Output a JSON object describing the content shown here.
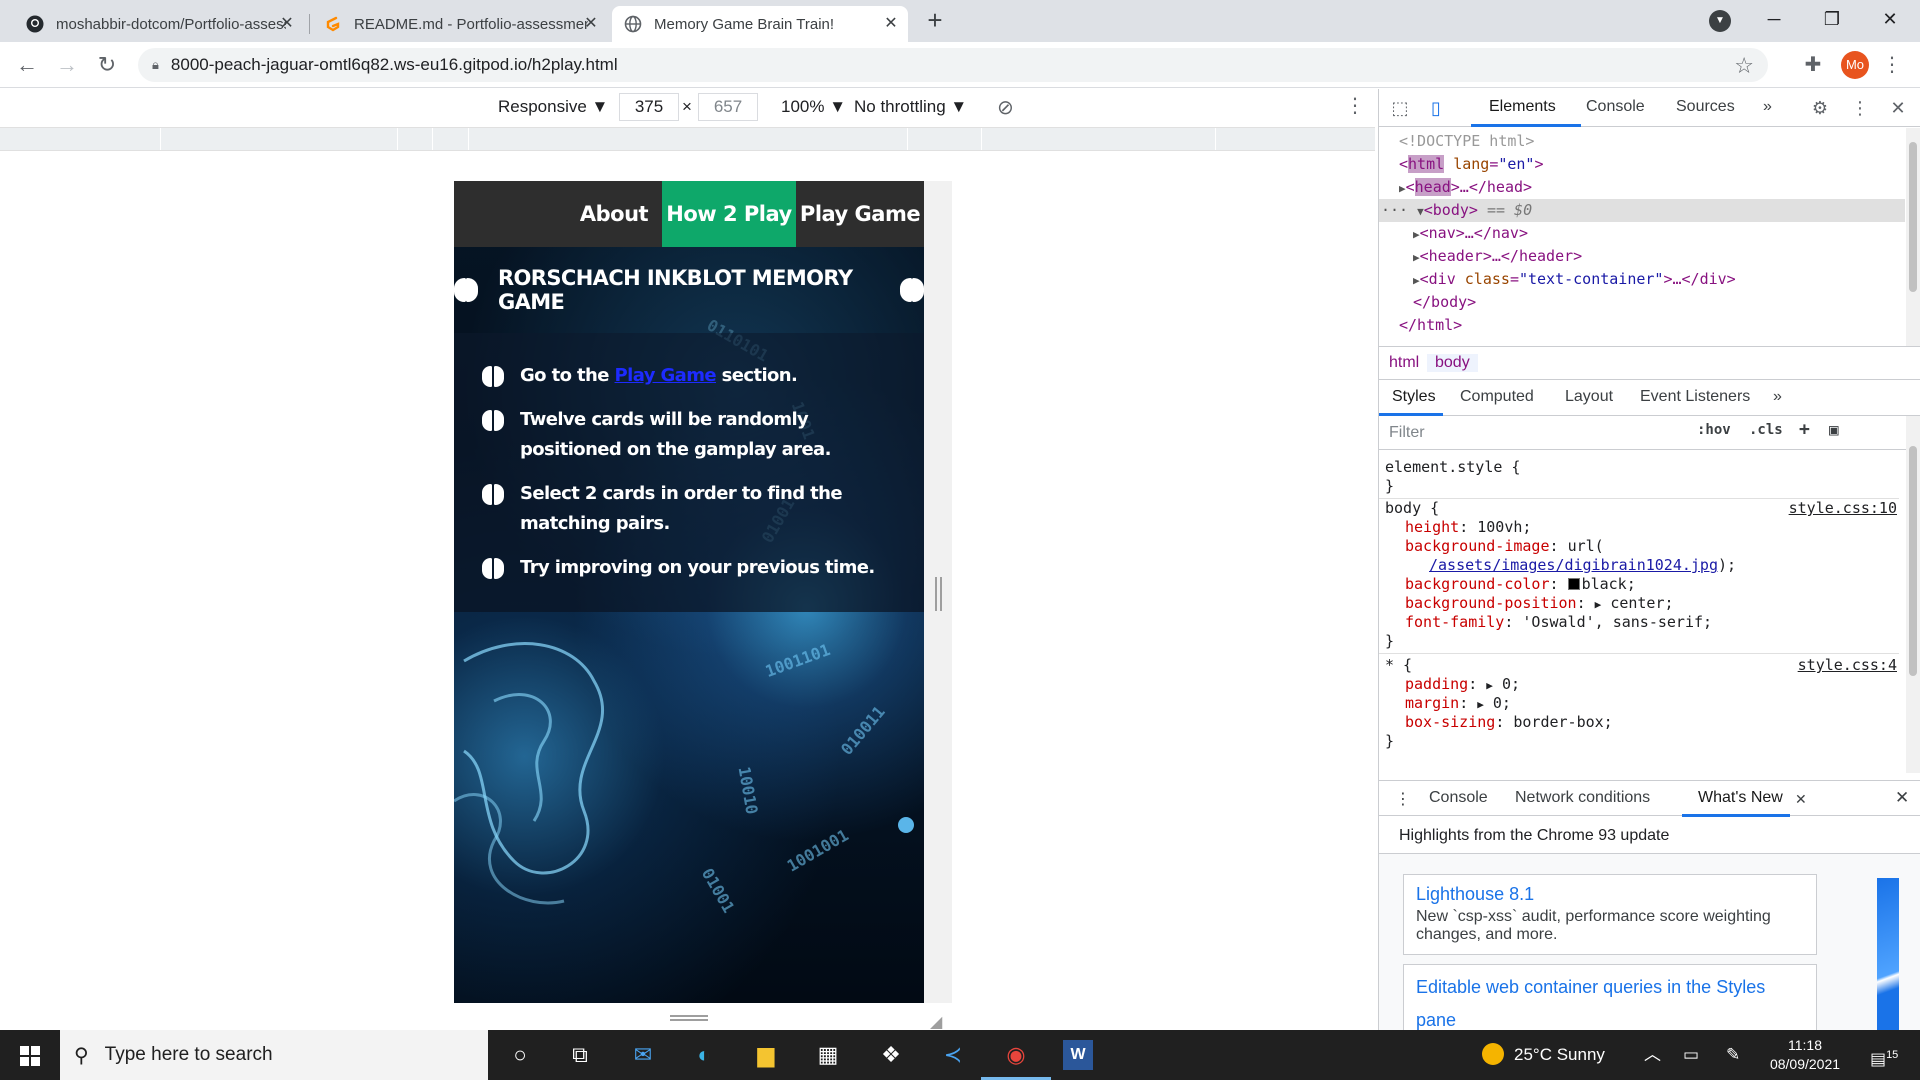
{
  "browser": {
    "tabs": [
      {
        "title": "moshabbir-dotcom/Portfolio-assessment",
        "icon": "github-icon"
      },
      {
        "title": "README.md - Portfolio-assessment",
        "icon": "gitpod-icon"
      },
      {
        "title": "Memory Game Brain Train!",
        "icon": "globe-icon"
      }
    ],
    "url": "8000-peach-jaguar-omtl6q82.ws-eu16.gitpod.io/h2play.html",
    "profile_initials": "Mo"
  },
  "device_toolbar": {
    "mode": "Responsive ▼",
    "width": "375",
    "times": "×",
    "height": "657",
    "zoom": "100% ▼",
    "throttle": "No throttling ▼"
  },
  "page": {
    "nav": {
      "about": "About",
      "how2play": "How 2 Play",
      "play": "Play Game"
    },
    "title": "RORSCHACH INKBLOT MEMORY GAME",
    "instructions": {
      "i1_pre": "Go to the",
      "i1_link": "Play Game",
      "i1_post": "section.",
      "i2": "Twelve cards will be randomly positioned on the gamplay area.",
      "i3": "Select 2 cards in order to find the matching pairs.",
      "i4": "Try improving on your previous time."
    },
    "digits": [
      "0110101",
      "1001",
      "01001",
      "1001101",
      "010011",
      "10010",
      "1001001",
      "01001"
    ]
  },
  "devtools": {
    "tabs": {
      "elements": "Elements",
      "console": "Console",
      "sources": "Sources",
      "more": "»"
    },
    "dom": {
      "doctype": "<!DOCTYPE html>",
      "html_tag": "html",
      "lang_attr": "lang",
      "lang_val": "\"en\"",
      "head_tag": "head",
      "head_rest": ">…</head>",
      "body_open": "<body>",
      "body_eq": " == $0",
      "nav": "<nav>…</nav>",
      "header": "<header>…</header>",
      "div_open": "<div ",
      "div_class_attr": "class",
      "div_class_val": "\"text-container\"",
      "div_rest": ">…</div>",
      "body_close": "</body>",
      "html_close": "</html>"
    },
    "crumbs": {
      "html": "html",
      "body": "body"
    },
    "subtabs": {
      "styles": "Styles",
      "computed": "Computed",
      "layout": "Layout",
      "listeners": "Event Listeners",
      "more": "»"
    },
    "filter": {
      "placeholder": "Filter",
      "hov": ":hov",
      "cls": ".cls"
    },
    "styles": {
      "element_style": "element.style {",
      "close_brace": "}",
      "body_sel": "body {",
      "body_src": "style.css:10",
      "height_prop": "height",
      "height_val": "100vh;",
      "bgimg_prop": "background-image",
      "bgimg_val": "url(",
      "bgimg_link": "/assets/images/digibrain1024.jpg",
      "bgimg_end": ");",
      "bgcolor_prop": "background-color",
      "bgcolor_val": "black;",
      "bgpos_prop": "background-position",
      "bgpos_val": "center;",
      "font_prop": "font-family",
      "font_val": "'Oswald', sans-serif;",
      "star_sel": "* {",
      "star_src": "style.css:4",
      "padding_prop": "padding",
      "padding_val": "0;",
      "margin_prop": "margin",
      "margin_val": "0;",
      "boxsizing_prop": "box-sizing",
      "boxsizing_val": "border-box;"
    },
    "drawer": {
      "console": "Console",
      "network": "Network conditions",
      "whatsnew": "What's New"
    },
    "whatsnew": {
      "heading": "Highlights from the Chrome 93 update",
      "card1_title": "Lighthouse 8.1",
      "card1_desc": "New `csp-xss` audit, performance score weighting changes, and more.",
      "card2_title": "Editable web container queries in the Styles pane"
    }
  },
  "taskbar": {
    "search": "Type here to search",
    "weather": "25°C  Sunny",
    "time": "11:18",
    "date": "08/09/2021",
    "notifications": "15"
  }
}
